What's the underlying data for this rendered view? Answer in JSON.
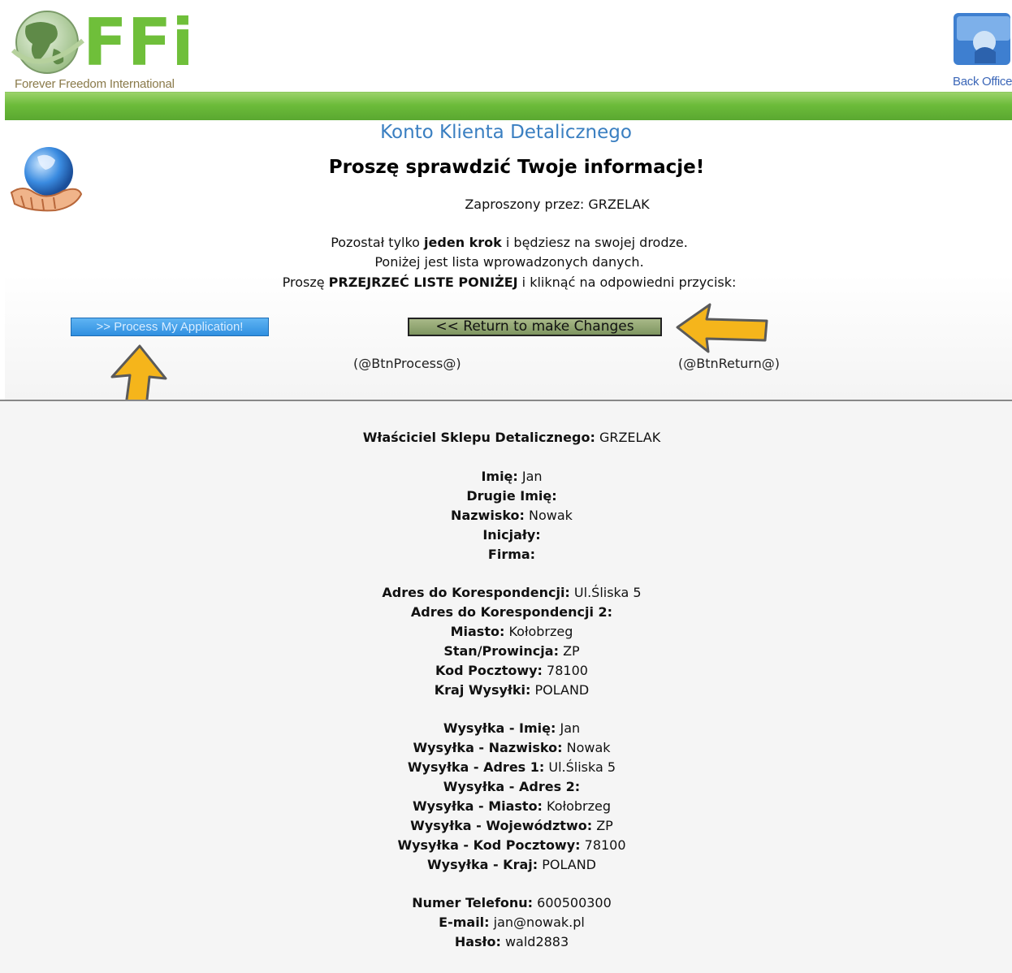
{
  "header": {
    "logo_text": "Forever Freedom International",
    "logo_letters": "FFi",
    "back_office_label": "Back Office"
  },
  "title": "Konto Klienta Detalicznego",
  "heading": "Proszę sprawdzić Twoje informacje!",
  "invited_by": "Zaproszony przez: GRZELAK",
  "instructions": {
    "line1_pre": "Pozostał tylko ",
    "line1_bold": "jeden krok",
    "line1_post": " i będziesz na swojej drodze.",
    "line2": "Poniżej jest lista wprowadzonych danych.",
    "line3_pre": "Proszę ",
    "line3_bold": "PRZEJRZEĆ LISTE PONIŻEJ",
    "line3_post": " i kliknąć na odpowiedni przycisk:"
  },
  "buttons": {
    "process_label": ">> Process My Application!",
    "return_label": "<< Return to make Changes",
    "process_placeholder": "(@BtnProcess@)",
    "return_placeholder": "(@BtnReturn@)"
  },
  "colors": {
    "green_bar": "#6cbb3a",
    "title_blue": "#3a7fc1",
    "arrow_orange": "#f5b51b"
  },
  "details": [
    {
      "label": "Właściciel Sklepu Detalicznego:",
      "value": "GRZELAK"
    },
    {
      "label": "Imię:",
      "value": "Jan"
    },
    {
      "label": "Drugie Imię:",
      "value": ""
    },
    {
      "label": "Nazwisko:",
      "value": "Nowak"
    },
    {
      "label": "Inicjały:",
      "value": ""
    },
    {
      "label": "Firma:",
      "value": ""
    },
    {
      "label": "Adres do Korespondencji:",
      "value": "Ul.Śliska 5"
    },
    {
      "label": "Adres do Korespondencji 2:",
      "value": ""
    },
    {
      "label": "Miasto:",
      "value": "Kołobrzeg"
    },
    {
      "label": "Stan/Prowincja:",
      "value": "ZP"
    },
    {
      "label": "Kod Pocztowy:",
      "value": "78100"
    },
    {
      "label": "Kraj Wysyłki:",
      "value": "POLAND"
    },
    {
      "label": "Wysyłka - Imię:",
      "value": "Jan"
    },
    {
      "label": "Wysyłka - Nazwisko:",
      "value": "Nowak"
    },
    {
      "label": "Wysyłka - Adres 1:",
      "value": "Ul.Śliska 5"
    },
    {
      "label": "Wysyłka - Adres 2:",
      "value": ""
    },
    {
      "label": "Wysyłka - Miasto:",
      "value": "Kołobrzeg"
    },
    {
      "label": "Wysyłka - Województwo:",
      "value": "ZP"
    },
    {
      "label": "Wysyłka - Kod Pocztowy:",
      "value": "78100"
    },
    {
      "label": "Wysyłka - Kraj:",
      "value": "POLAND"
    },
    {
      "label": "Numer Telefonu:",
      "value": "600500300"
    },
    {
      "label": "E-mail:",
      "value": "jan@nowak.pl"
    },
    {
      "label": "Hasło:",
      "value": "wald2883"
    }
  ]
}
